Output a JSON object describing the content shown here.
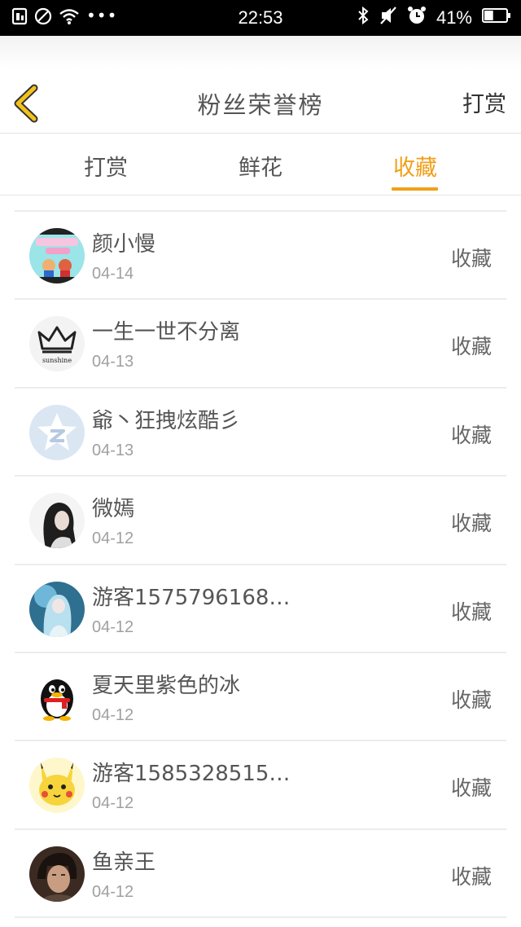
{
  "status_bar": {
    "time": "22:53",
    "battery_percent": "41%",
    "left_icons": [
      "sim-icon",
      "no-disturb-icon",
      "wifi-icon",
      "more-icon"
    ],
    "right_icons": [
      "bluetooth-icon",
      "mute-icon",
      "alarm-icon",
      "battery-icon"
    ],
    "more_dots": "•••",
    "battery_level": 0.41
  },
  "nav": {
    "title": "粉丝荣誉榜",
    "action": "打赏",
    "back_icon": "chevron-left-icon",
    "back_color": "#f2c21b"
  },
  "tabs": [
    {
      "label": "打赏",
      "active": false
    },
    {
      "label": "鲜花",
      "active": false
    },
    {
      "label": "收藏",
      "active": true
    }
  ],
  "accent_color": "#f0a01a",
  "list": [
    {
      "name": "颜小慢",
      "date": "04-14",
      "action": "收藏",
      "avatar": "cartoon-cover-avatar"
    },
    {
      "name": "一生一世不分离",
      "date": "04-13",
      "action": "收藏",
      "avatar": "crown-sunshine-avatar"
    },
    {
      "name": "爺丶狂拽炫酷彡",
      "date": "04-13",
      "action": "收藏",
      "avatar": "default-qq-avatar"
    },
    {
      "name": "微嫣",
      "date": "04-12",
      "action": "收藏",
      "avatar": "girl-photo-avatar"
    },
    {
      "name": "游客1575796168…",
      "date": "04-12",
      "action": "收藏",
      "avatar": "anime-girl-avatar"
    },
    {
      "name": "夏天里紫色的冰",
      "date": "04-12",
      "action": "收藏",
      "avatar": "qq-penguin-avatar"
    },
    {
      "name": "游客1585328515…",
      "date": "04-12",
      "action": "收藏",
      "avatar": "pikachu-avatar"
    },
    {
      "name": "鱼亲王",
      "date": "04-12",
      "action": "收藏",
      "avatar": "man-photo-avatar"
    }
  ]
}
